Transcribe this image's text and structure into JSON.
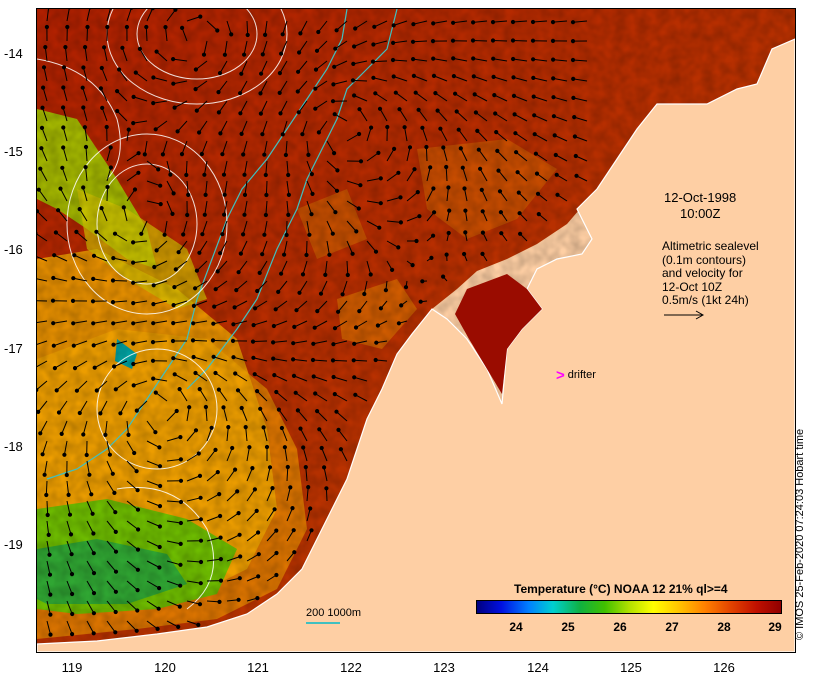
{
  "map": {
    "lat_ticks": [
      "-14",
      "-15",
      "-16",
      "-17",
      "-18",
      "-19"
    ],
    "lon_ticks": [
      "119",
      "120",
      "121",
      "122",
      "123",
      "124",
      "125",
      "126"
    ],
    "lat_range": [
      -20.0,
      -13.6
    ],
    "lon_range": [
      118.7,
      126.7
    ]
  },
  "annotations": {
    "date": "12-Oct-1998",
    "time": "10:00Z",
    "legend_lines": [
      "Altimetric sealevel",
      "(0.1m contours)",
      "and velocity for",
      "12-Oct 10Z",
      "0.5m/s (1kt 24h)"
    ],
    "drifter_symbol": ">",
    "drifter_label": "drifter"
  },
  "colorbar": {
    "title": "Temperature (°C) NOAA 12 21% ql>=4",
    "ticks": [
      "24",
      "25",
      "26",
      "27",
      "28",
      "29"
    ],
    "range": [
      23.3,
      29.1
    ],
    "colors": [
      "#000080",
      "#0080ff",
      "#00d0d0",
      "#40c000",
      "#ffff00",
      "#ff8000",
      "#900000"
    ]
  },
  "scale": {
    "label": "200  1000m"
  },
  "credit": "© IMOS 25-Feb-2020 07:24:03 Hobart time",
  "colors": {
    "land": "#fecfa4",
    "bathymetry": "#40c0c0",
    "contour": "#ffffff",
    "arrow": "#000000"
  }
}
